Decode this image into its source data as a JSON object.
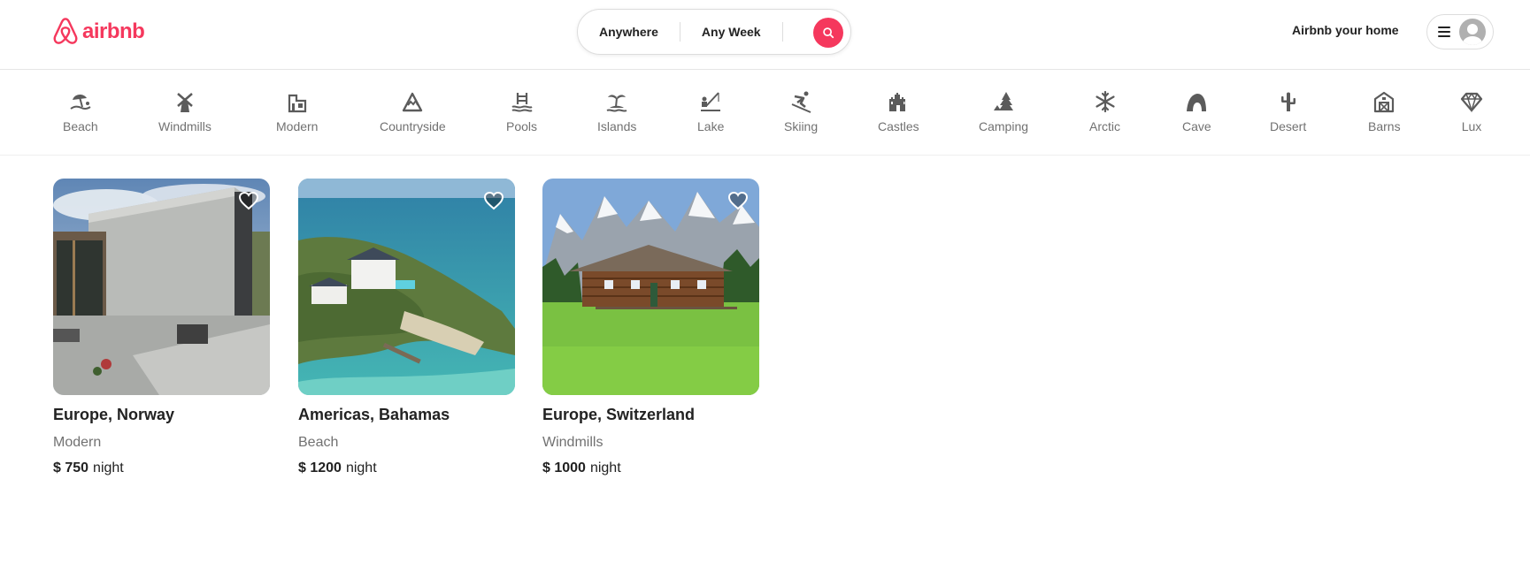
{
  "header": {
    "logo_text": "airbnb",
    "search": {
      "where": "Anywhere",
      "when": "Any Week",
      "icon": "search-icon"
    },
    "host_link": "Airbnb your home",
    "user_menu": {
      "menu_icon": "hamburger-icon",
      "avatar_icon": "user-avatar-icon"
    }
  },
  "categories": [
    {
      "label": "Beach",
      "icon": "beach-umbrella-icon"
    },
    {
      "label": "Windmills",
      "icon": "windmill-icon"
    },
    {
      "label": "Modern",
      "icon": "modern-house-icon"
    },
    {
      "label": "Countryside",
      "icon": "mountain-icon"
    },
    {
      "label": "Pools",
      "icon": "pool-icon"
    },
    {
      "label": "Islands",
      "icon": "island-icon"
    },
    {
      "label": "Lake",
      "icon": "lake-fishing-icon"
    },
    {
      "label": "Skiing",
      "icon": "skier-icon"
    },
    {
      "label": "Castles",
      "icon": "castle-icon"
    },
    {
      "label": "Camping",
      "icon": "camping-tree-icon"
    },
    {
      "label": "Arctic",
      "icon": "snowflake-icon"
    },
    {
      "label": "Cave",
      "icon": "cave-icon"
    },
    {
      "label": "Desert",
      "icon": "cactus-icon"
    },
    {
      "label": "Barns",
      "icon": "barn-icon"
    },
    {
      "label": "Lux",
      "icon": "diamond-icon"
    }
  ],
  "listings": [
    {
      "location": "Europe, Norway",
      "category": "Modern",
      "price": "$ 750",
      "price_unit": "night",
      "favorite_icon": "heart-icon"
    },
    {
      "location": "Americas, Bahamas",
      "category": "Beach",
      "price": "$ 1200",
      "price_unit": "night",
      "favorite_icon": "heart-icon"
    },
    {
      "location": "Europe, Switzerland",
      "category": "Windmills",
      "price": "$ 1000",
      "price_unit": "night",
      "favorite_icon": "heart-icon"
    }
  ],
  "colors": {
    "brand": "#F5385D",
    "text": "#222222",
    "muted": "#717171",
    "border": "#dddddd"
  }
}
